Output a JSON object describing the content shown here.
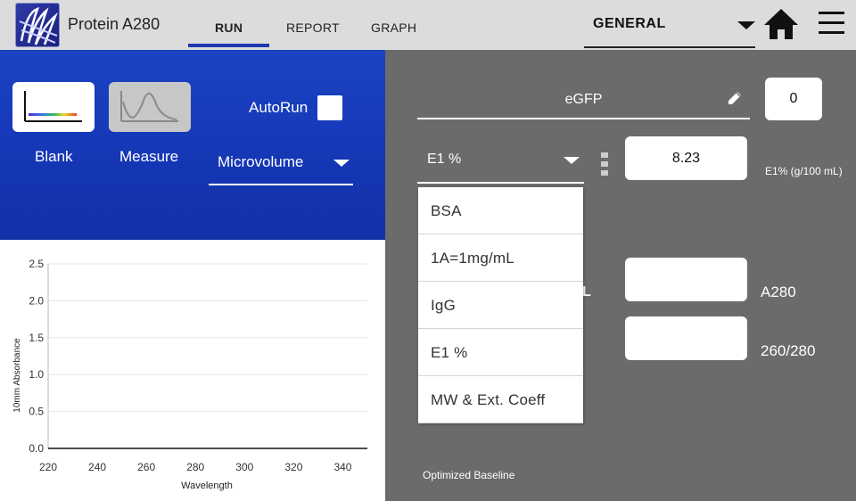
{
  "app": {
    "title": "Protein A280"
  },
  "tabs": [
    {
      "label": "RUN",
      "active": true
    },
    {
      "label": "REPORT",
      "active": false
    },
    {
      "label": "GRAPH",
      "active": false
    }
  ],
  "header": {
    "config_select": "GENERAL"
  },
  "controls": {
    "blank_label": "Blank",
    "measure_label": "Measure",
    "autorun_label": "AutoRun",
    "autorun_checked": false,
    "measurement_mode": "Microvolume"
  },
  "sample": {
    "name": "eGFP",
    "count": "0",
    "method": "E1 %",
    "e1_value": "8.23",
    "e1_unit": "E1% (g/100 mL)",
    "a280_value": "",
    "a280_label": "A280",
    "ratio_value": "",
    "ratio_label": "260/280",
    "partial_label": "L",
    "footer": "Optimized Baseline"
  },
  "dropdown": {
    "options": [
      "BSA",
      "1A=1mg/mL",
      "IgG",
      "E1 %",
      "MW & Ext. Coeff"
    ]
  },
  "colors": {
    "accent": "#1e36b0",
    "panel_blue": "#1638b8",
    "panel_gray": "#6b6b6b",
    "topbar": "#dcdcdc"
  },
  "chart_data": {
    "type": "line",
    "xlabel": "Wavelength",
    "ylabel": "10mm Absorbance",
    "xlim": [
      220,
      350
    ],
    "ylim": [
      0,
      2.5
    ],
    "x_ticks": [
      220,
      240,
      260,
      280,
      300,
      320,
      340
    ],
    "y_ticks": [
      0.0,
      0.5,
      1.0,
      1.5,
      2.0,
      2.5
    ],
    "y_tick_labels": [
      "0.0",
      "0.5",
      "1.0",
      "1.5",
      "2.0",
      "2.5"
    ],
    "grid": true,
    "series": []
  }
}
